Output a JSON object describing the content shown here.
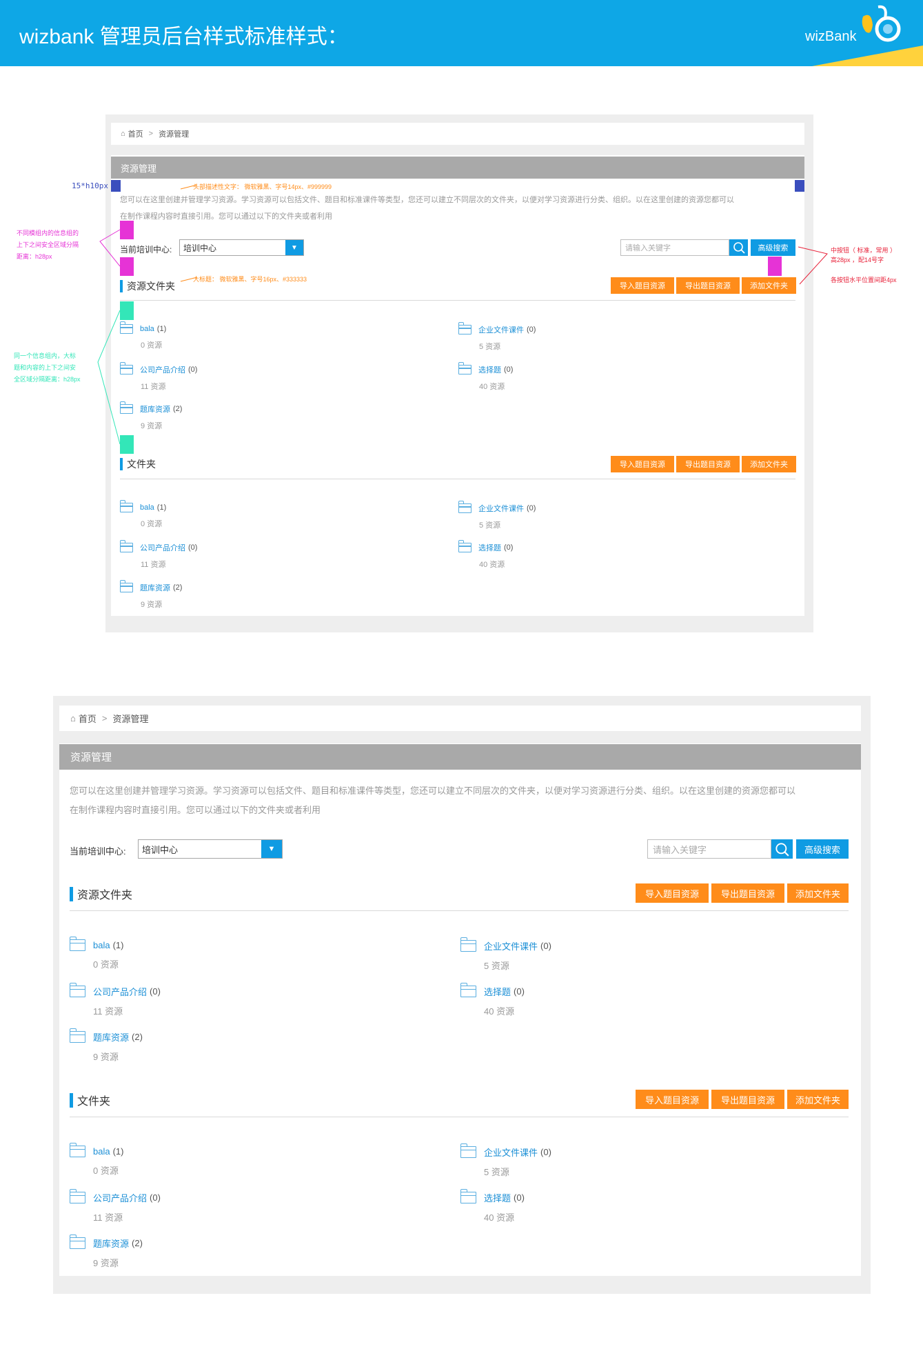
{
  "header": {
    "title": "wizbank 管理员后台样式标准样式：",
    "brand": "wizBank"
  },
  "annotations": {
    "spacing": "15*h10px",
    "desc_note": "头部描述性文字： 微软雅黑、字号14px、#999999",
    "group_gap_note": [
      "不同模组内的信息组的",
      "上下之间安全区域分隔",
      "距离：h28px"
    ],
    "title_note": "大标题： 微软雅黑、字号16px、#333333",
    "inner_gap_note": [
      "同一个信息组内，大标",
      "题和内容的上下之间安",
      "全区域分隔距离：h28px"
    ],
    "button_note": [
      "中按钮（ 标准，常用 ）",
      "高28px ，配14号字"
    ],
    "button_gap_note": "各按钮水平位置间距4px"
  },
  "colors": {
    "accent": "#0f9be3",
    "orange": "#ff8c1a",
    "header_bg": "#0ea7e6",
    "title_bar": "#a9a9a9",
    "link": "#1b8fd6"
  },
  "page": {
    "breadcrumb": {
      "home_icon": "home-icon",
      "home": "首页",
      "separator": ">",
      "current": "资源管理"
    },
    "title": "资源管理",
    "description_line1": "您可以在这里创建并管理学习资源。学习资源可以包括文件、题目和标准课件等类型，您还可以建立不同层次的文件夹，以便对学习资源进行分类、组织。以在这里创建的资源您都可以",
    "description_line2": "在制作课程内容时直接引用。您可以通过以下的文件夹或者利用",
    "center_label": "当前培训中心:",
    "center_value": "培训中心",
    "search_placeholder": "请输入关键字",
    "advanced_search": "高级搜索",
    "sections": [
      {
        "title": "资源文件夹",
        "buttons": [
          "导入题目资源",
          "导出题目资源",
          "添加文件夹"
        ]
      },
      {
        "title": "文件夹",
        "buttons": [
          "导入题目资源",
          "导出题目资源",
          "添加文件夹"
        ]
      }
    ],
    "folders": [
      {
        "name": "bala",
        "count": "(1)",
        "sub": "0 资源"
      },
      {
        "name": "企业文件课件",
        "count": "(0)",
        "sub": "5 资源"
      },
      {
        "name": "公司产品介绍",
        "count": "(0)",
        "sub": "11 资源"
      },
      {
        "name": "选择题",
        "count": "(0)",
        "sub": "40 资源"
      },
      {
        "name": "题库资源",
        "count": "(2)",
        "sub": "9 资源"
      }
    ]
  }
}
